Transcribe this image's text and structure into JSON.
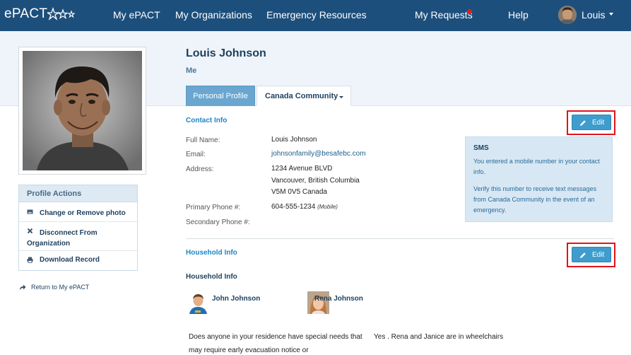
{
  "nav": {
    "logo": "ePACT",
    "items": [
      "My ePACT",
      "My Organizations",
      "Emergency Resources",
      "My Requests",
      "Help"
    ],
    "user": "Louis"
  },
  "profile": {
    "name": "Louis Johnson",
    "relation": "Me"
  },
  "actions": {
    "title": "Profile Actions",
    "change_photo": "Change or Remove photo",
    "disconnect": "Disconnect From Organization",
    "download": "Download Record",
    "return_link": "Return to My ePACT"
  },
  "tabs": {
    "personal": "Personal Profile",
    "community": "Canada Community"
  },
  "contact": {
    "title": "Contact Info",
    "edit": "Edit",
    "labels": {
      "full_name": "Full Name:",
      "email": "Email:",
      "address": "Address:",
      "primary_phone": "Primary Phone #:",
      "secondary_phone": "Secondary Phone #:"
    },
    "values": {
      "full_name": "Louis Johnson",
      "email": "johnsonfamily@besafebc.com",
      "address_line1": "1234 Avenue BLVD",
      "address_line2": "Vancouver, British Columbia",
      "address_line3": "V5M 0V5 Canada",
      "primary_phone": "604-555-1234",
      "primary_phone_type": "(Mobile)"
    }
  },
  "sms": {
    "title": "SMS",
    "text1": "You entered a mobile number in your contact info.",
    "text2": "Verify this number to receive text messages from Canada Community in the event of an emergency."
  },
  "household": {
    "title": "Household Info",
    "edit": "Edit",
    "subtitle": "Household Info",
    "members": [
      {
        "name": "John Johnson"
      },
      {
        "name": "Rena Johnson"
      }
    ],
    "question": "Does anyone in your residence have special needs that may require early evacuation notice or",
    "answer": "Yes . Rena and Janice are in wheelchairs"
  },
  "colors": {
    "nav_bg": "#1d4f7c",
    "accent": "#1f85c6",
    "edit_button": "#3f9dcd",
    "highlight_outline": "#e0141c",
    "notification": "#e02020"
  }
}
